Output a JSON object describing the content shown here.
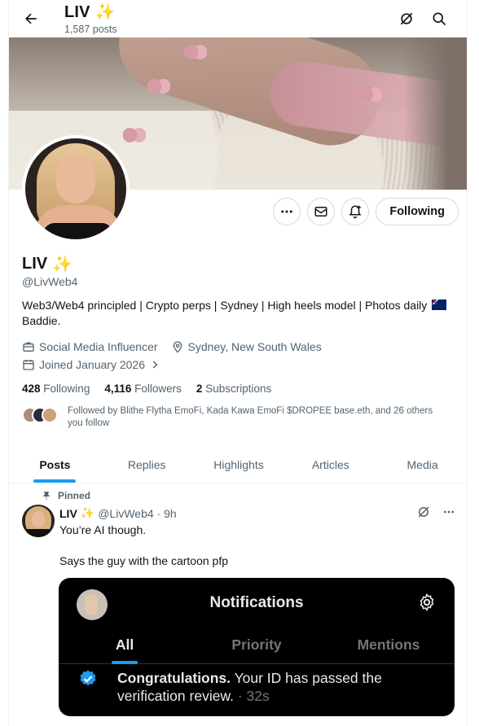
{
  "header": {
    "title": "LIV",
    "title_emoji": "✨",
    "post_count": "1,587 posts"
  },
  "profile": {
    "name": "LIV",
    "name_emoji": "✨",
    "handle": "@LivWeb4",
    "bio_line": "Web3/Web4 principled | Crypto perps | Sydney | High heels model | Photos daily",
    "bio_line2": "Baddie.",
    "category": "Social Media Influencer",
    "location": "Sydney, New South Wales",
    "joined": "Joined January 2026",
    "following_count": "428",
    "following_label": "Following",
    "followers_count": "4,116",
    "followers_label": "Followers",
    "subscriptions_count": "2",
    "subscriptions_label": "Subscriptions",
    "followed_by": "Followed by Blithe Flytha EmoFi, Kada Kawa EmoFi $DROPEE base.eth, and 26 others you follow"
  },
  "actions": {
    "follow_label": "Following"
  },
  "tabs": [
    {
      "label": "Posts",
      "active": true
    },
    {
      "label": "Replies",
      "active": false
    },
    {
      "label": "Highlights",
      "active": false
    },
    {
      "label": "Articles",
      "active": false
    },
    {
      "label": "Media",
      "active": false
    }
  ],
  "post": {
    "pinned_label": "Pinned",
    "author": "LIV",
    "author_emoji": "✨",
    "handle_time": "@LivWeb4 · 9h",
    "text1": "You’re AI though.",
    "text2": "Says the guy with the cartoon pfp",
    "image": {
      "title": "Notifications",
      "tabs": [
        "All",
        "Priority",
        "Mentions"
      ],
      "msg_bold": "Congratulations.",
      "msg_rest": " Your ID has passed the verification review.",
      "msg_time": " · 32s"
    }
  },
  "colors": {
    "accent": "#1d9bf0",
    "text": "#0f1419",
    "muted": "#536471",
    "border": "#cfd9de"
  }
}
